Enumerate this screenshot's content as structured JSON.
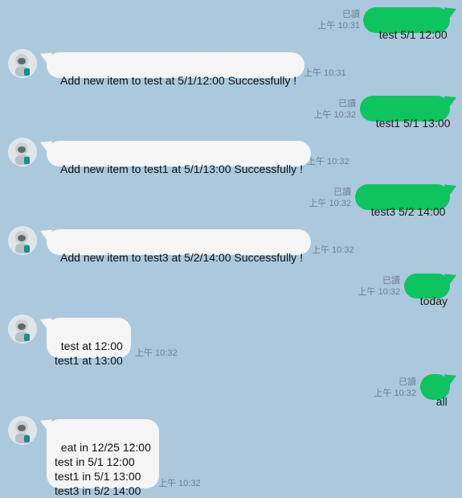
{
  "messages": [
    {
      "side": "out",
      "text": "test 5/1 12:00",
      "read": "已讀",
      "time": "上午 10:31"
    },
    {
      "side": "in",
      "text": "Add new item to test at 5/1/12:00 Successfully !",
      "time": "上午 10:31"
    },
    {
      "side": "out",
      "text": "test1 5/1 13:00",
      "read": "已讀",
      "time": "上午 10:32"
    },
    {
      "side": "in",
      "text": "Add new item to test1 at 5/1/13:00 Successfully !",
      "time": "上午 10:32"
    },
    {
      "side": "out",
      "text": "test3 5/2 14:00",
      "read": "已讀",
      "time": "上午 10:32"
    },
    {
      "side": "in",
      "text": "Add new item to test3 at 5/2/14:00 Successfully !",
      "time": "上午 10:32"
    },
    {
      "side": "out",
      "text": "today",
      "read": "已讀",
      "time": "上午 10:32"
    },
    {
      "side": "in",
      "text": "test at 12:00\ntest1 at 13:00",
      "time": "上午 10:32"
    },
    {
      "side": "out",
      "text": "all",
      "read": "已讀",
      "time": "上午 10:32"
    },
    {
      "side": "in",
      "text": "eat in 12/25 12:00\ntest in 5/1 12:00\ntest1 in 5/1 13:00\ntest3 in 5/2 14:00",
      "time": "上午 10:32"
    }
  ],
  "colors": {
    "background": "#abc8dd",
    "outgoing": "#0dc45f",
    "incoming": "#f5f5f5"
  },
  "icons": {
    "bot_avatar": "robot-avatar-icon"
  }
}
